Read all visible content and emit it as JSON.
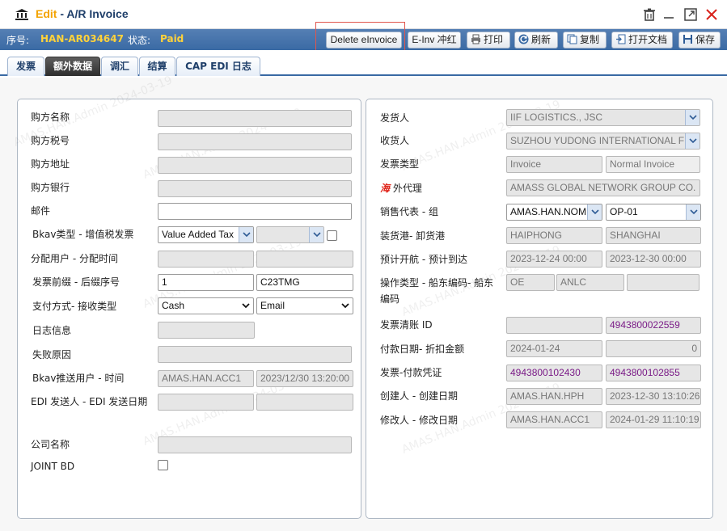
{
  "window": {
    "mode": "Edit",
    "separator": " - ",
    "title": "A/R Invoice"
  },
  "status": {
    "serial_label": "序号:",
    "serial_value": "HAN-AR034647",
    "state_label": "状态:",
    "state_value": "Paid"
  },
  "toolbar": {
    "delete_einvoice": "Delete eInvoice",
    "einv_reverse": "E-Inv 冲红",
    "print": "打印",
    "refresh": "刷新",
    "copy": "复制",
    "open_doc": "打开文档",
    "save": "保存"
  },
  "tabs": [
    {
      "label": "发票"
    },
    {
      "label": "额外数据"
    },
    {
      "label": "调汇"
    },
    {
      "label": "结算"
    },
    {
      "label": "CAP EDI 日志"
    }
  ],
  "left": {
    "buyer_name": {
      "label": "购方名称",
      "value": ""
    },
    "buyer_tax": {
      "label": "购方税号",
      "value": ""
    },
    "buyer_address": {
      "label": "购方地址",
      "value": ""
    },
    "buyer_bank": {
      "label": "购方银行",
      "value": ""
    },
    "email": {
      "label": "邮件",
      "value": ""
    },
    "bkav_type": {
      "label": "Bkav类型 - 增值税发票",
      "value": "Value Added Tax",
      "second": ""
    },
    "assign": {
      "label": "分配用户 - 分配时间",
      "value1": "",
      "value2": ""
    },
    "prefix": {
      "label": "发票前缀 - 后缀序号",
      "value1": "1",
      "value2": "C23TMG"
    },
    "payment": {
      "label": "支付方式- 接收类型",
      "value1": "Cash",
      "value2": "Email"
    },
    "log_info": {
      "label": "日志信息",
      "value": ""
    },
    "fail_reason": {
      "label": "失败原因",
      "value": ""
    },
    "bkav_push": {
      "label": "Bkav推送用户 - 时间",
      "value1": "AMAS.HAN.ACC1",
      "value2": "2023/12/30 13:20:00"
    },
    "edi_sender": {
      "label": "EDI 发送人 - EDI 发送日期",
      "value1": "",
      "value2": ""
    },
    "company": {
      "label": "公司名称",
      "value": ""
    },
    "joint_bd": {
      "label": "JOINT BD"
    }
  },
  "right": {
    "shipper": {
      "label": "发货人",
      "value": "IIF LOGISTICS., JSC"
    },
    "consignee": {
      "label": "收货人",
      "value": "SUZHOU YUDONG INTERNATIONAL F"
    },
    "invoice_type": {
      "label": "发票类型",
      "value1": "Invoice",
      "value2": "Normal Invoice"
    },
    "overseas_agent": {
      "mark": "海",
      "label": "外代理",
      "value": "AMASS GLOBAL NETWORK GROUP CO."
    },
    "sales_rep": {
      "label": "销售代表 - 组",
      "value1": "AMAS.HAN.NOM",
      "value2": "OP-01"
    },
    "ports": {
      "label": "装货港- 卸货港",
      "value1": "HAIPHONG",
      "value2": "SHANGHAI"
    },
    "etd_eta": {
      "label": "预计开航 - 预计到达",
      "value1": "2023-12-24 00:00",
      "value2": "2023-12-30 00:00"
    },
    "op_type": {
      "label": "操作类型 - 船东编码- 船东编码",
      "value1": "OE",
      "value2": "ANLC",
      "value3": ""
    },
    "invoice_clear": {
      "label": "发票清账 ID",
      "value1": "",
      "value2": "4943800022559"
    },
    "pay_date": {
      "label": "付款日期- 折扣金额",
      "value1": "2024-01-24",
      "value2": "0"
    },
    "inv_voucher": {
      "label": "发票-付款凭证",
      "value1": "4943800102430",
      "value2": "4943800102855"
    },
    "creator": {
      "label": "创建人 - 创建日期",
      "value1": "AMAS.HAN.HPH",
      "value2": "2023-12-30 13:10:26"
    },
    "modifier": {
      "label": "修改人 - 修改日期",
      "value1": "AMAS.HAN.ACC1",
      "value2": "2024-01-29 11:10:19"
    }
  },
  "watermark": "AMAS.HAN.Admin 2024-03-19",
  "colors": {
    "accent": "#3a6aa4",
    "mode": "#f3a300",
    "status_value": "#ffd23a",
    "purple_text": "#7a1b87"
  }
}
